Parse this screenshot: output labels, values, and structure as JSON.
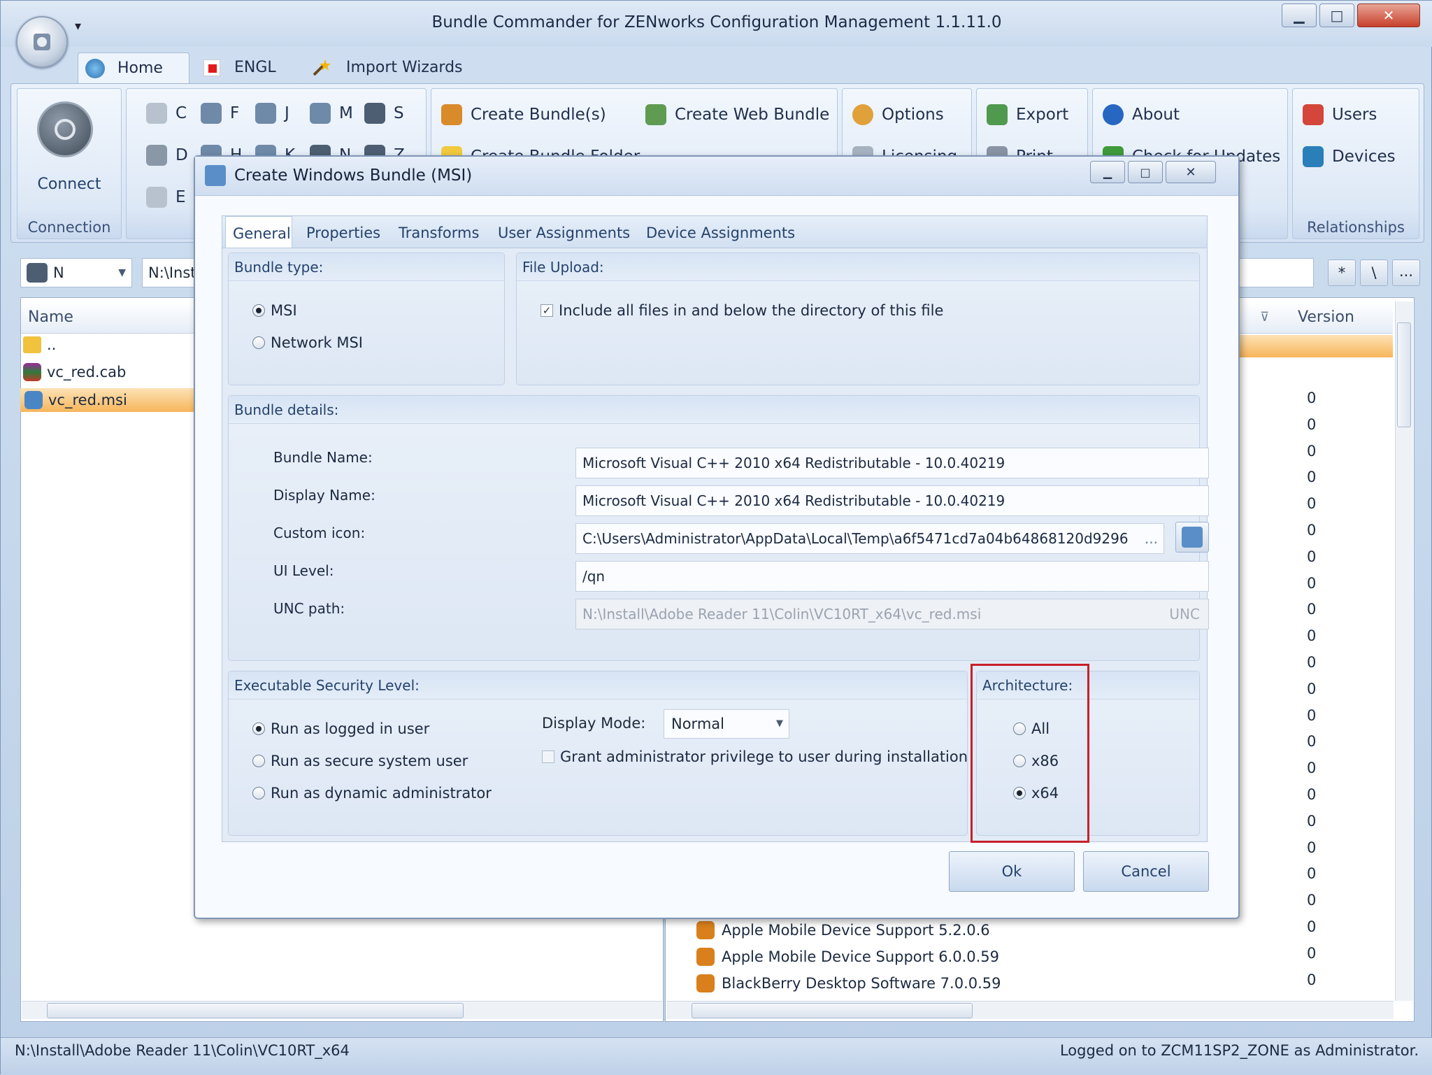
{
  "app": {
    "title": "Bundle Commander for ZENworks Configuration Management 1.1.11.0",
    "quick_access_arrow": "▾",
    "window_buttons": {
      "minimize": "▁",
      "maximize": "□",
      "close": "✕"
    }
  },
  "ribbon_tabs": [
    {
      "label": "Home"
    },
    {
      "label": "ENGL"
    },
    {
      "label": "Import Wizards"
    }
  ],
  "ribbon": {
    "connection": {
      "button": "Connect",
      "group_label": "Connection"
    },
    "drives": {
      "row1": [
        "C",
        "F",
        "J",
        "M",
        "S"
      ],
      "row2": [
        "D",
        "H",
        "K",
        "N",
        "Z"
      ],
      "row3": [
        "E"
      ]
    },
    "bundle": {
      "create_bundles": "Create Bundle(s)",
      "create_web_bundle": "Create Web Bundle",
      "create_bundle_folder": "Create Bundle Folder"
    },
    "options": {
      "options": "Options",
      "licensing": "Licensing"
    },
    "export": {
      "export": "Export",
      "print": "Print"
    },
    "about": {
      "about": "About",
      "check_updates": "Check for Updates"
    },
    "relationships": {
      "users": "Users",
      "devices": "Devices",
      "group_label": "Relationships"
    }
  },
  "browser": {
    "drive_select": "N",
    "path": "N:\\Inst",
    "path_buttons": [
      "*",
      "\\",
      "..."
    ],
    "left_column": "Name",
    "right_column": "Version",
    "files": [
      {
        "name": ".."
      },
      {
        "name": "vc_red.cab"
      },
      {
        "name": "vc_red.msi"
      }
    ],
    "version_values": [
      "0",
      "0",
      "0",
      "0",
      "0",
      "0",
      "0",
      "0",
      "0",
      "0",
      "0",
      "0",
      "0",
      "0",
      "0",
      "0",
      "0",
      "0",
      "0",
      "0",
      "0",
      "0",
      "0"
    ],
    "tree_items": [
      {
        "name": "Apple Mobile Device Support 5.2.0.6"
      },
      {
        "name": "Apple Mobile Device Support 6.0.0.59"
      },
      {
        "name": "BlackBerry Desktop Software 7.0.0.59"
      }
    ]
  },
  "statusbar": {
    "path": "N:\\Install\\Adobe Reader 11\\Colin\\VC10RT_x64",
    "logon": "Logged on to ZCM11SP2_ZONE as Administrator."
  },
  "dialog": {
    "title": "Create Windows Bundle (MSI)",
    "tabs": [
      {
        "label": "General"
      },
      {
        "label": "Properties"
      },
      {
        "label": "Transforms"
      },
      {
        "label": "User Assignments"
      },
      {
        "label": "Device Assignments"
      }
    ],
    "bundle_type": {
      "header": "Bundle type:",
      "options": [
        {
          "label": "MSI",
          "selected": true
        },
        {
          "label": "Network MSI",
          "selected": false
        }
      ]
    },
    "file_upload": {
      "header": "File Upload:",
      "include_label": "Include all files in and below the directory of this file",
      "include_checked": true
    },
    "bundle_details": {
      "header": "Bundle details:",
      "bundle_name_label": "Bundle Name:",
      "bundle_name": "Microsoft Visual C++ 2010  x64 Redistributable - 10.0.40219",
      "display_name_label": "Display Name:",
      "display_name": "Microsoft Visual C++ 2010  x64 Redistributable - 10.0.40219",
      "custom_icon_label": "Custom icon:",
      "custom_icon": "C:\\Users\\Administrator\\AppData\\Local\\Temp\\a6f5471cd7a04b64868120d9296",
      "custom_icon_browse": "...",
      "ui_level_label": "UI Level:",
      "ui_level": "/qn",
      "unc_label": "UNC path:",
      "unc_path": "N:\\Install\\Adobe Reader 11\\Colin\\VC10RT_x64\\vc_red.msi",
      "unc_suffix": "UNC"
    },
    "security": {
      "header": "Executable Security Level:",
      "options": [
        {
          "label": "Run as logged in user",
          "selected": true
        },
        {
          "label": "Run as secure system user",
          "selected": false
        },
        {
          "label": "Run as dynamic administrator",
          "selected": false
        }
      ],
      "display_mode_label": "Display Mode:",
      "display_mode": "Normal",
      "grant_label": "Grant administrator privilege to user during installation",
      "grant_checked": false
    },
    "architecture": {
      "header": "Architecture:",
      "options": [
        {
          "label": "All",
          "selected": false
        },
        {
          "label": "x86",
          "selected": false
        },
        {
          "label": "x64",
          "selected": true
        }
      ],
      "highlight_color": "#c8202a"
    },
    "ok": "Ok",
    "cancel": "Cancel"
  },
  "colors": {
    "accent": "#24426c",
    "selection": "#f7b55a",
    "ribbon_bg": "#d4e2f3"
  }
}
